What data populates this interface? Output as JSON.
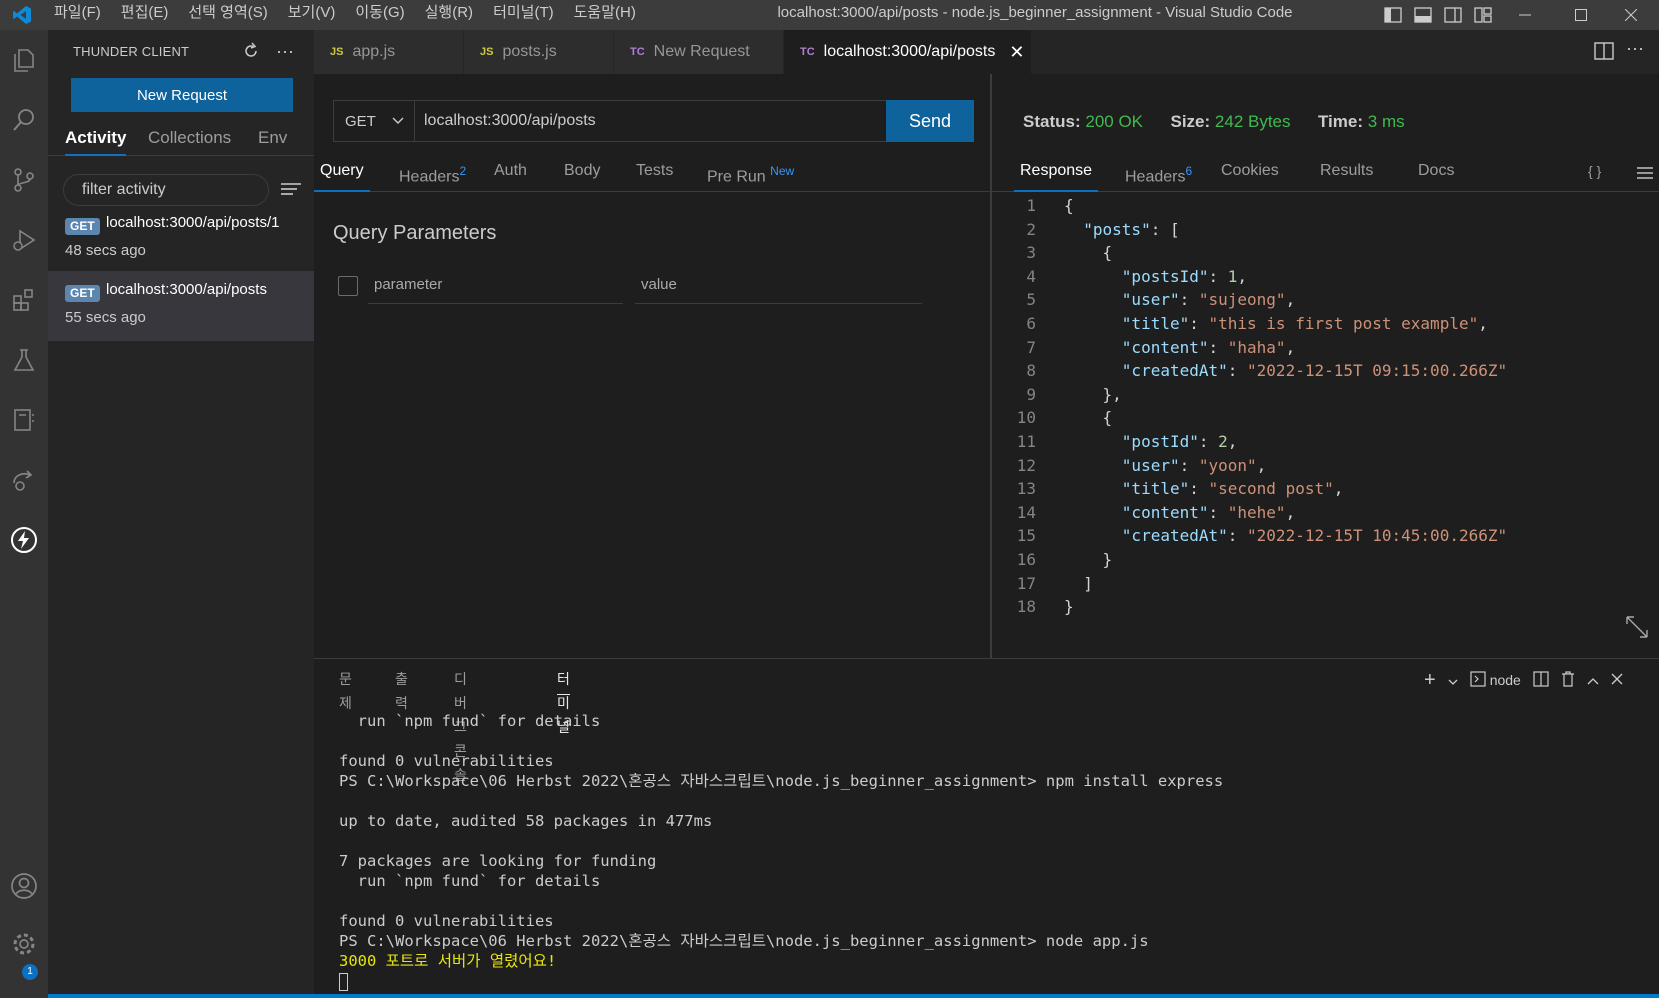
{
  "titlebar": {
    "menu": [
      "파일(F)",
      "편집(E)",
      "선택 영역(S)",
      "보기(V)",
      "이동(G)",
      "실행(R)",
      "터미널(T)",
      "도움말(H)"
    ],
    "window_title": "localhost:3000/api/posts - node.js_beginner_assignment - Visual Studio Code"
  },
  "activitybar": {
    "settings_badge": "1"
  },
  "sidebar": {
    "title": "THUNDER CLIENT",
    "new_request_label": "New Request",
    "tabs": [
      "Activity",
      "Collections",
      "Env"
    ],
    "filter_placeholder": "filter activity",
    "activity": [
      {
        "method": "GET",
        "url": "localhost:3000/api/posts/1",
        "time": "48 secs ago"
      },
      {
        "method": "GET",
        "url": "localhost:3000/api/posts",
        "time": "55 secs ago"
      }
    ]
  },
  "editor_tabs": [
    {
      "icon": "JS",
      "label": "app.js"
    },
    {
      "icon": "JS",
      "label": "posts.js"
    },
    {
      "icon": "TC",
      "label": "New Request"
    },
    {
      "icon": "TC",
      "label": "localhost:3000/api/posts"
    }
  ],
  "request": {
    "method": "GET",
    "url": "localhost:3000/api/posts",
    "send_label": "Send",
    "tabs": [
      "Query",
      "Headers",
      "Auth",
      "Body",
      "Tests",
      "Pre Run"
    ],
    "headers_count": "2",
    "prerun_badge": "New",
    "query_title": "Query Parameters",
    "param_placeholder": "parameter",
    "value_placeholder": "value"
  },
  "response": {
    "status_label": "Status:",
    "status_value": "200 OK",
    "size_label": "Size:",
    "size_value": "242 Bytes",
    "time_label": "Time:",
    "time_value": "3 ms",
    "tabs": [
      "Response",
      "Headers",
      "Cookies",
      "Results",
      "Docs"
    ],
    "headers_count": "6",
    "braces_label": "{ }"
  },
  "terminal": {
    "tabs": [
      "문제",
      "출력",
      "디버그 콘솔",
      "터미널"
    ],
    "shell_label": "node",
    "lines": [
      "  run `npm fund` for details",
      "",
      "found 0 vulnerabilities",
      "PS C:\\Workspace\\06 Herbst 2022\\혼공스 자바스크립트\\node.js_beginner_assignment> npm install express",
      "",
      "up to date, audited 58 packages in 477ms",
      "",
      "7 packages are looking for funding",
      "  run `npm fund` for details",
      "",
      "found 0 vulnerabilities",
      "PS C:\\Workspace\\06 Herbst 2022\\혼공스 자바스크립트\\node.js_beginner_assignment> node app.js",
      "3000 포트로 서버가 열렸어요!"
    ]
  },
  "colors": {
    "accent": "#0e70c0",
    "button": "#0e639c",
    "status_ok": "#3fb950",
    "json_key": "#9cdcfe",
    "json_string": "#ce9178",
    "json_number": "#b5cea8"
  }
}
